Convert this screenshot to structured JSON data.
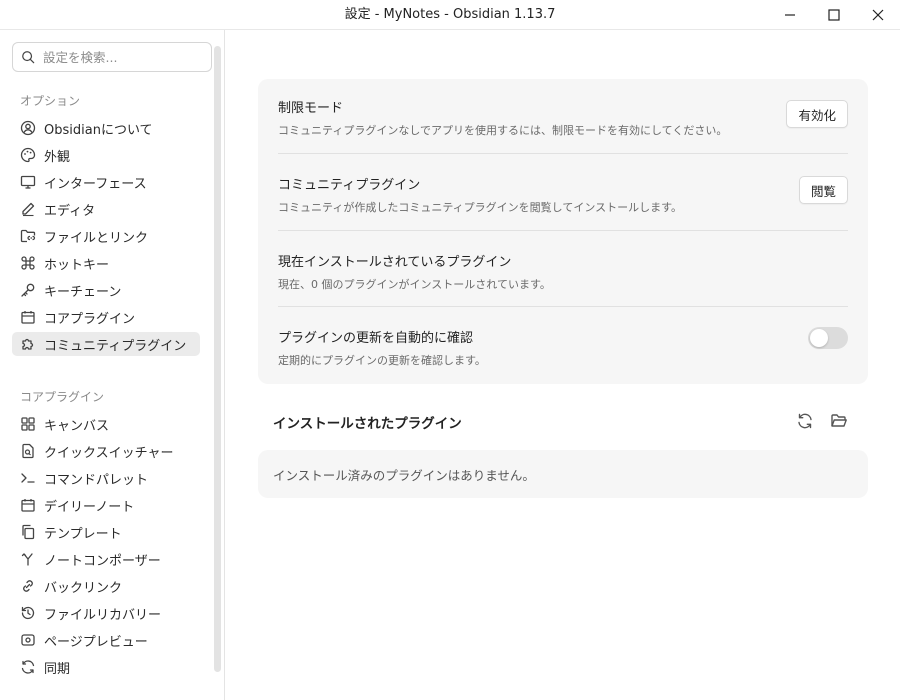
{
  "window": {
    "title": "設定 - MyNotes - Obsidian 1.13.7"
  },
  "search": {
    "placeholder": "設定を検索..."
  },
  "sidebar": {
    "options_label": "オプション",
    "options": [
      {
        "label": "Obsidianについて",
        "icon": "user-circle-icon"
      },
      {
        "label": "外観",
        "icon": "palette-icon"
      },
      {
        "label": "インターフェース",
        "icon": "monitor-icon"
      },
      {
        "label": "エディタ",
        "icon": "pencil-icon"
      },
      {
        "label": "ファイルとリンク",
        "icon": "folder-link-icon"
      },
      {
        "label": "ホットキー",
        "icon": "command-icon"
      },
      {
        "label": "キーチェーン",
        "icon": "key-icon"
      },
      {
        "label": "コアプラグイン",
        "icon": "calendar-box-icon"
      },
      {
        "label": "コミュニティプラグイン",
        "icon": "puzzle-icon"
      }
    ],
    "core_label": "コアプラグイン",
    "core": [
      {
        "label": "キャンバス",
        "icon": "grid-icon"
      },
      {
        "label": "クイックスイッチャー",
        "icon": "file-search-icon"
      },
      {
        "label": "コマンドパレット",
        "icon": "terminal-icon"
      },
      {
        "label": "デイリーノート",
        "icon": "calendar-icon"
      },
      {
        "label": "テンプレート",
        "icon": "copy-icon"
      },
      {
        "label": "ノートコンポーザー",
        "icon": "merge-icon"
      },
      {
        "label": "バックリンク",
        "icon": "link-icon"
      },
      {
        "label": "ファイルリカバリー",
        "icon": "history-icon"
      },
      {
        "label": "ページプレビュー",
        "icon": "eye-icon"
      },
      {
        "label": "同期",
        "icon": "refresh-icon"
      }
    ]
  },
  "settings": {
    "restricted": {
      "name": "制限モード",
      "desc": "コミュニティプラグインなしでアプリを使用するには、制限モードを有効にしてください。",
      "button": "有効化"
    },
    "community": {
      "name": "コミュニティプラグイン",
      "desc": "コミュニティが作成したコミュニティプラグインを閲覧してインストールします。",
      "button": "閲覧"
    },
    "installed_now": {
      "name": "現在インストールされているプラグイン",
      "desc": "現在、0 個のプラグインがインストールされています。"
    },
    "auto_update": {
      "name": "プラグインの更新を自動的に確認",
      "desc": "定期的にプラグインの更新を確認します。",
      "enabled": false
    }
  },
  "installed": {
    "header": "インストールされたプラグイン",
    "empty": "インストール済みのプラグインはありません。"
  }
}
